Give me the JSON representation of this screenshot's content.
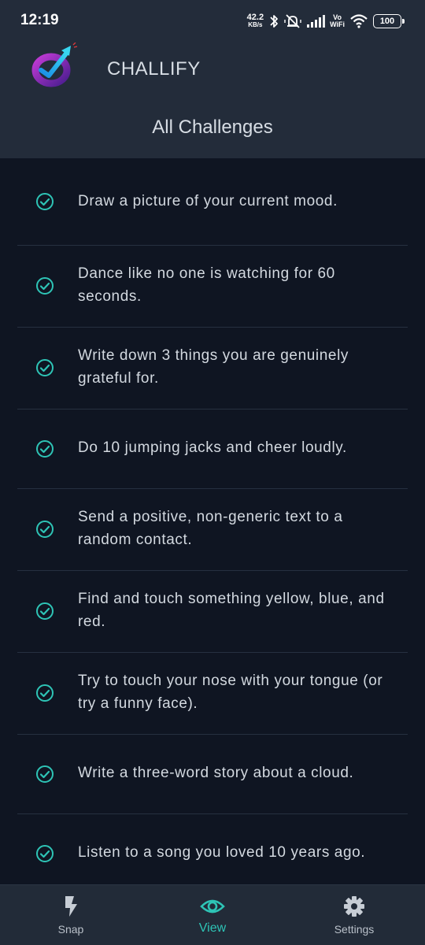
{
  "status_bar": {
    "time": "12:19",
    "net_speed_value": "42.2",
    "net_speed_unit": "KB/s",
    "vo_top": "Vo",
    "vo_bottom": "WiFi",
    "battery": "100"
  },
  "header": {
    "app_title": "CHALLIFY",
    "page_title": "All Challenges"
  },
  "colors": {
    "accent": "#2ec4b6",
    "background": "#0f1522",
    "header_bg": "#232c3a",
    "nav_bg": "#222b38"
  },
  "challenges": [
    {
      "text": "Draw a picture of your current mood.",
      "icon": "check-circle-icon"
    },
    {
      "text": "Dance like no one is watching for 60 seconds.",
      "icon": "check-circle-icon"
    },
    {
      "text": "Write down 3 things you are genuinely grateful for.",
      "icon": "check-circle-icon"
    },
    {
      "text": "Do 10 jumping jacks and cheer loudly.",
      "icon": "check-circle-icon"
    },
    {
      "text": "Send a positive, non-generic text to a random contact.",
      "icon": "check-circle-icon"
    },
    {
      "text": "Find and touch something yellow, blue, and red.",
      "icon": "check-circle-icon"
    },
    {
      "text": "Try to touch your nose with your tongue (or try a funny face).",
      "icon": "check-circle-icon"
    },
    {
      "text": "Write a three-word story about a cloud.",
      "icon": "check-circle-icon"
    },
    {
      "text": "Listen to a song you loved 10 years ago.",
      "icon": "check-circle-icon"
    }
  ],
  "bottom_nav": {
    "items": [
      {
        "label": "Snap",
        "icon": "lightning-icon",
        "active": false
      },
      {
        "label": "View",
        "icon": "eye-icon",
        "active": true
      },
      {
        "label": "Settings",
        "icon": "gear-icon",
        "active": false
      }
    ]
  }
}
